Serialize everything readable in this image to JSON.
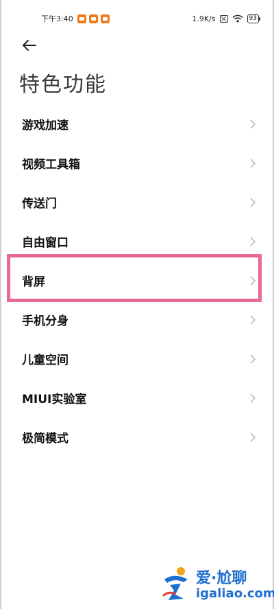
{
  "status_bar": {
    "time": "下午3:40",
    "speed": "1.9K/s",
    "battery": "93",
    "icons": [
      "notification-icon",
      "notification-icon",
      "notification-icon",
      "sim-disabled-icon",
      "wifi-icon",
      "battery-icon"
    ]
  },
  "header": {
    "back_icon": "back-arrow-icon",
    "title": "特色功能"
  },
  "list": {
    "items": [
      {
        "label": "游戏加速"
      },
      {
        "label": "视频工具箱"
      },
      {
        "label": "传送门"
      },
      {
        "label": "自由窗口"
      },
      {
        "label": "背屏",
        "highlighted": true
      },
      {
        "label": "手机分身"
      },
      {
        "label": "儿童空间"
      },
      {
        "label": "MIUI实验室"
      },
      {
        "label": "极简模式"
      }
    ],
    "chevron_icon": "chevron-right-icon"
  },
  "colors": {
    "highlight_border": "#ea6a95",
    "notification": "#f07a18",
    "watermark": "#1f6fcf"
  },
  "watermark": {
    "line1": "爱·尬聊",
    "line2": "igaliao.com"
  }
}
